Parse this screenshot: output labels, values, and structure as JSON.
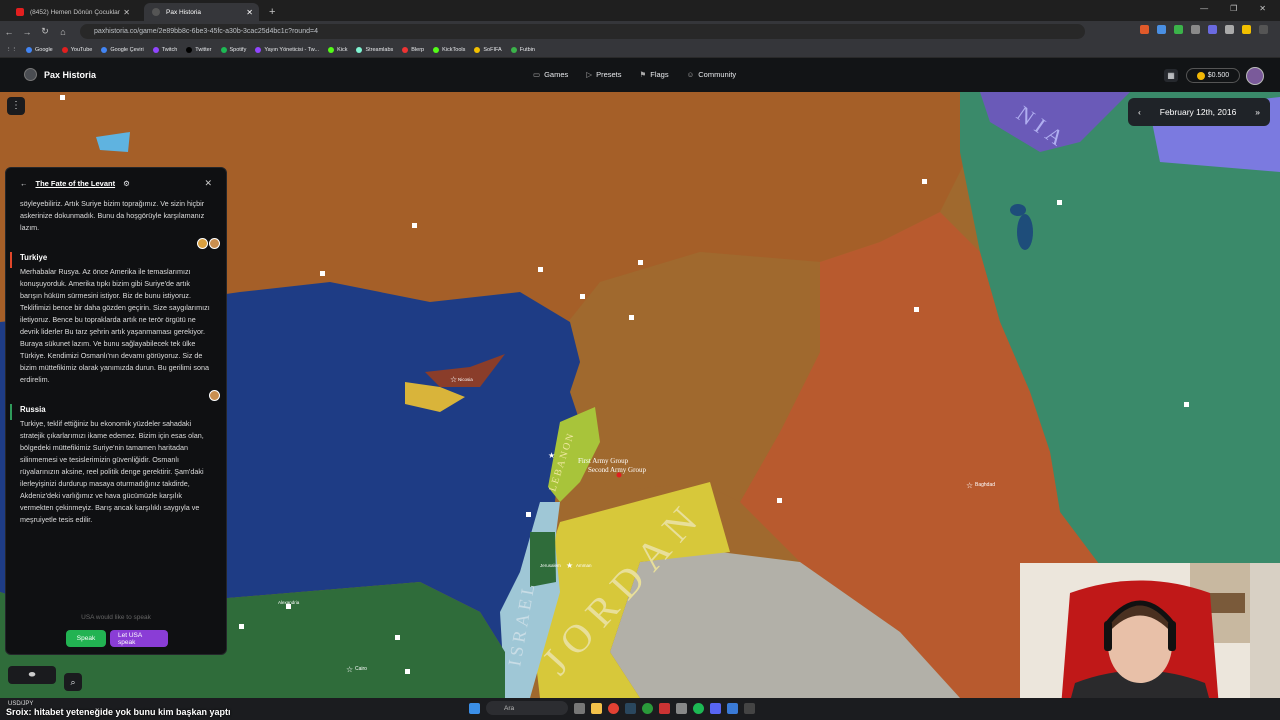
{
  "browser": {
    "tabs": [
      {
        "label": "(8452) Hemen Dönün Çocuklar",
        "active": false
      },
      {
        "label": "Pax Historia",
        "active": true
      }
    ],
    "url": "paxhistoria.co/game/2e89bb8c-6be3-45fc-a30b-3cac25d4bc1c?round=4",
    "bookmarks": [
      "Google",
      "YouTube",
      "Google Çeviri",
      "Twitch",
      "Twitter",
      "Spotify",
      "Yayın Yöneticisi - Tw...",
      "Kick",
      "Streamlabs",
      "Blerp",
      "KickTools",
      "SoFIFA",
      "Futbin"
    ]
  },
  "app": {
    "logo": "Pax Historia",
    "nav": [
      {
        "icon": "gamepad-icon",
        "label": "Games"
      },
      {
        "icon": "play-icon",
        "label": "Presets"
      },
      {
        "icon": "flag-icon",
        "label": "Flags"
      },
      {
        "icon": "people-icon",
        "label": "Community"
      }
    ],
    "balance": "$0.500",
    "date": "February 12th, 2016"
  },
  "map": {
    "labels": {
      "lebanon": "LEBANON",
      "jordan": "JORDAN",
      "israel": "ISRAEL",
      "first_army": "First Army Group",
      "second_army": "Second Army Group",
      "baghdad": "Baghdad",
      "cairo": "Cairo",
      "nicosia": "Nicosia",
      "alexandria": "Alexandria",
      "amman": "Amman",
      "jerusalem": "Jerusalem",
      "nia": "NIA"
    },
    "colors": {
      "sea": "#1e3c85",
      "syria": "#a0692e",
      "turkey": "#a55e28",
      "iraq": "#b85a2e",
      "iran": "#3a8a6a",
      "jordan": "#d7c83a",
      "lebanon": "#a8c43a",
      "israel": "#9fc7d6",
      "egypt": "#2f6c3a",
      "saudi": "#b2b0a8"
    }
  },
  "panel": {
    "title": "The Fate of the Levant",
    "messages": [
      {
        "speaker": "",
        "text": "söyleyebiliriz. Artık Suriye bizim toprağımız. Ve sizin hiçbir askerinize dokunmadık. Bunu da hoşgörüyle karşılamanız lazım."
      },
      {
        "speaker": "Turkiye",
        "text": "Merhabalar Rusya. Az önce Amerika ile temaslarımızı konuşuyorduk. Amerika tıpkı bizim gibi Suriye'de artık barışın hüküm sürmesini istiyor. Biz de bunu istiyoruz. Teklifimizi bence bir daha gözden geçirin. Size saygılarımızı iletiyoruz. Bence bu topraklarda artık ne terör örgütü ne devrik liderler Bu tarz şehrin artık yaşanmaması gerekiyor. Buraya sükunet lazım. Ve bunu sağlayabilecek tek ülke Türkiye. Kendimizi Osmanlı'nın devamı görüyoruz. Siz de bizim müttefikimiz olarak yanımızda durun. Bu gerilimi sona erdirelim."
      },
      {
        "speaker": "Russia",
        "text": "Turkiye, teklif ettiğiniz bu ekonomik yüzdeler sahadaki stratejik çıkarlarımızı ikame edemez. Bizim için esas olan, bölgedeki müttefikimiz Suriye'nin tamamen haritadan silinmemesi ve tesislerimizin güvenliğidir. Osmanlı rüyalarınızın aksine, reel politik denge gerektirir. Şam'daki ilerleyişinizi durdurup masaya oturmadığınız takdirde, Akdeniz'deki varlığımız ve hava gücümüzle karşılık vermekten çekinmeyiz. Barış ancak karşılıklı saygıyla ve meşruiyetle tesis edilir."
      }
    ],
    "usa_prompt": "USA would like to speak",
    "speak_label": "Speak",
    "let_usa_label": "Let USA speak"
  },
  "taskbar": {
    "ticker": "USD/JPY",
    "search": "Ara",
    "subtitle": "Sroix: hitabet yeteneğide yok bunu kim başkan yaptı"
  }
}
